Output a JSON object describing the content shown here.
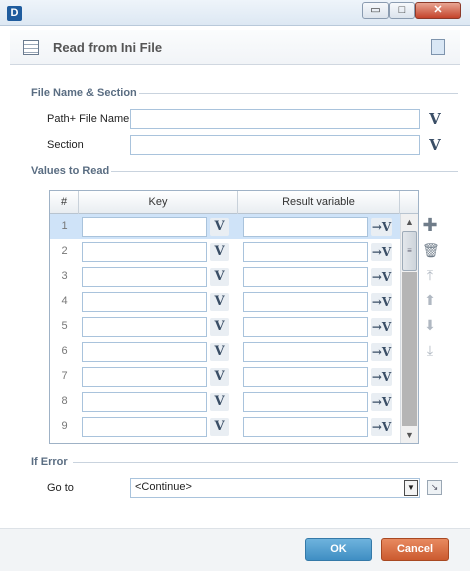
{
  "window": {
    "app_icon": "D",
    "controls": {
      "minimize": "▭",
      "maximize": "□",
      "close": "✕"
    }
  },
  "header": {
    "title": "Read from Ini File",
    "icon": "table-icon",
    "note_icon": "note-icon"
  },
  "file_section": {
    "title": "File Name & Section",
    "path_label": "Path+ File Name",
    "path_value": "",
    "section_label": "Section",
    "section_value": "",
    "variable_button": "V"
  },
  "values_section": {
    "title": "Values to Read",
    "columns": {
      "num": "#",
      "key": "Key",
      "result": "Result variable"
    },
    "rows": [
      {
        "n": "1",
        "key": "",
        "result": ""
      },
      {
        "n": "2",
        "key": "",
        "result": ""
      },
      {
        "n": "3",
        "key": "",
        "result": ""
      },
      {
        "n": "4",
        "key": "",
        "result": ""
      },
      {
        "n": "5",
        "key": "",
        "result": ""
      },
      {
        "n": "6",
        "key": "",
        "result": ""
      },
      {
        "n": "7",
        "key": "",
        "result": ""
      },
      {
        "n": "8",
        "key": "",
        "result": ""
      },
      {
        "n": "9",
        "key": "",
        "result": ""
      }
    ],
    "selected_row": 1,
    "variable_button": "V",
    "result_button": "→V",
    "side_tools": [
      "add-icon",
      "delete-icon",
      "move-top-icon",
      "move-up-icon",
      "move-down-icon",
      "move-bottom-icon"
    ]
  },
  "error_section": {
    "title": "If Error",
    "goto_label": "Go to",
    "goto_value": "<Continue>"
  },
  "footer": {
    "ok": "OK",
    "cancel": "Cancel"
  },
  "colors": {
    "ok": "#4a9ad0",
    "cancel": "#d66a3d",
    "accent": "#a9c3dc",
    "selected_row": "#cfe3f8"
  }
}
